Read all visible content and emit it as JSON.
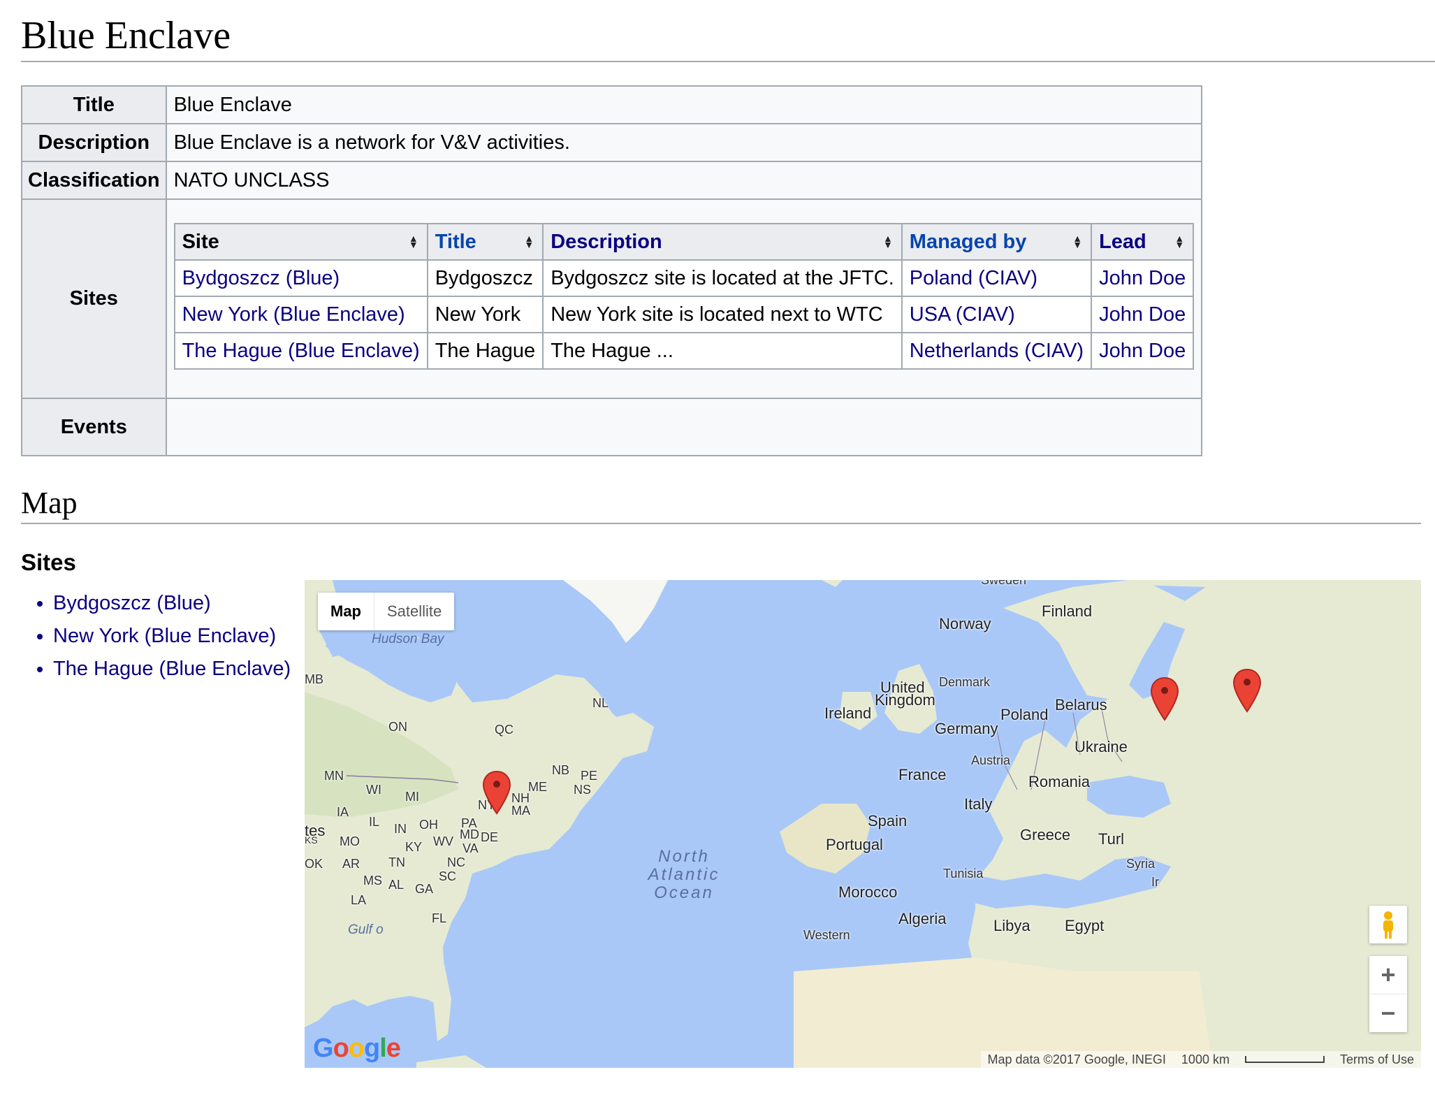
{
  "page": {
    "title": "Blue Enclave"
  },
  "infobox": {
    "title_label": "Title",
    "title_value": "Blue Enclave",
    "description_label": "Description",
    "description_value": "Blue Enclave is a network for V&V activities.",
    "classification_label": "Classification",
    "classification_value": "NATO UNCLASS",
    "sites_label": "Sites",
    "events_label": "Events"
  },
  "sites_table": {
    "headers": [
      "Site",
      "Title",
      "Description",
      "Managed by",
      "Lead"
    ],
    "rows": [
      {
        "site": "Bydgoszcz (Blue)",
        "title": "Bydgoszcz",
        "description": "Bydgoszcz site is located at the JFTC.",
        "managed_by": "Poland (CIAV)",
        "lead": "John Doe"
      },
      {
        "site": "New York (Blue Enclave)",
        "title": "New York",
        "description": "New York site is located next to WTC",
        "managed_by": "USA (CIAV)",
        "lead": "John Doe"
      },
      {
        "site": "The Hague (Blue Enclave)",
        "title": "The Hague",
        "description": "The Hague ...",
        "managed_by": "Netherlands (CIAV)",
        "lead": "John Doe"
      }
    ]
  },
  "map_section": {
    "heading": "Map",
    "subheading": "Sites",
    "list": [
      "Bydgoszcz (Blue)",
      "New York (Blue Enclave)",
      "The Hague (Blue Enclave)"
    ]
  },
  "map": {
    "type_map": "Map",
    "type_satellite": "Satellite",
    "labels": {
      "hudson_bay": "Hudson Bay",
      "mb": "MB",
      "nl": "NL",
      "on": "ON",
      "qc": "QC",
      "nb": "NB",
      "pe": "PE",
      "me": "ME",
      "ns": "NS",
      "mn": "MN",
      "wi": "WI",
      "mi": "MI",
      "nh": "NH",
      "ny": "NY",
      "ma": "MA",
      "ia": "IA",
      "il": "IL",
      "in": "IN",
      "oh": "OH",
      "pa": "PA",
      "md": "MD",
      "de": "DE",
      "wv": "WV",
      "va": "VA",
      "ky": "KY",
      "mo": "MO",
      "tes": "tes",
      "ks": "KS",
      "ok": "OK",
      "ar": "AR",
      "tn": "TN",
      "nc": "NC",
      "ms": "MS",
      "al": "AL",
      "ga": "GA",
      "sc": "SC",
      "la": "LA",
      "fl": "FL",
      "gulf": "Gulf o",
      "ocean_1": "North",
      "ocean_2": "Atlantic",
      "ocean_3": "Ocean",
      "finland": "Finland",
      "norway": "Norway",
      "sweden": "Sweden",
      "denmark": "Denmark",
      "united_kingdom_1": "United",
      "united_kingdom_2": "Kingdom",
      "ireland": "Ireland",
      "belarus": "Belarus",
      "poland": "Poland",
      "germany": "Germany",
      "ukraine": "Ukraine",
      "austria": "Austria",
      "france": "France",
      "romania": "Romania",
      "italy": "Italy",
      "spain": "Spain",
      "portugal": "Portugal",
      "greece": "Greece",
      "turkey": "Turl",
      "syria": "Syria",
      "iraq": "Ir",
      "tunisia": "Tunisia",
      "morocco": "Morocco",
      "algeria": "Algeria",
      "libya": "Libya",
      "egypt": "Egypt",
      "western": "Western"
    },
    "attribution": "Map data ©2017 Google, INEGI",
    "scale": "1000 km",
    "terms": "Terms of Use",
    "zoom_in": "+",
    "zoom_out": "−",
    "logo": "Google",
    "colors": {
      "water": "#a9c8f8",
      "land": "#e8ecd8",
      "pin": "#ea4335"
    }
  }
}
